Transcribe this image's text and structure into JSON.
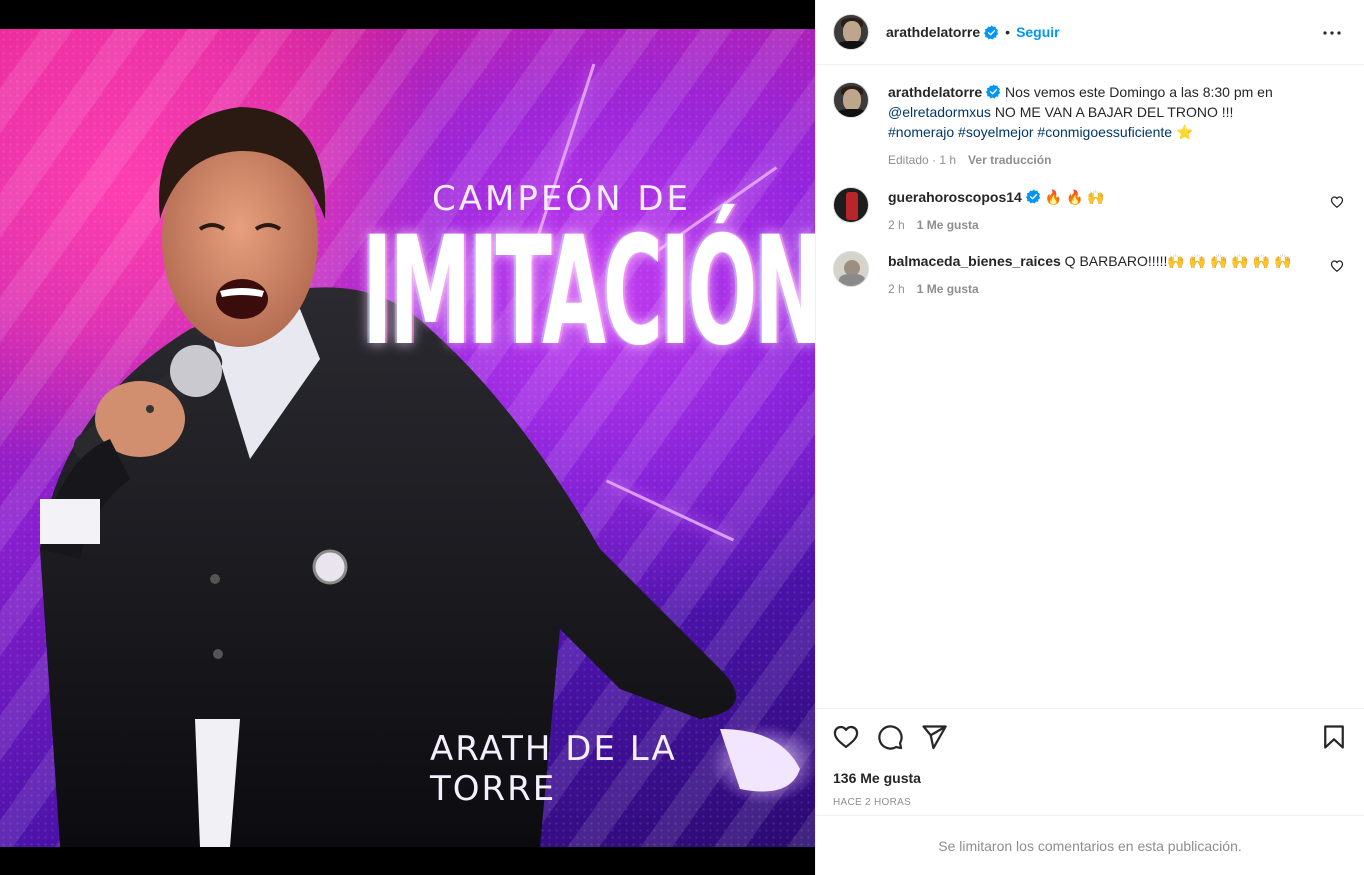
{
  "post": {
    "media": {
      "title_top": "CAMPEÓN DE",
      "title_main": "IMITACIÓN",
      "name_bottom": "ARATH DE LA TORRE"
    },
    "author": {
      "username": "arathdelatorre",
      "separator": "•",
      "follow_label": "Seguir",
      "more_icon": "more-horizontal-icon",
      "verified_icon": "verified-badge-icon"
    },
    "caption": {
      "username": "arathdelatorre",
      "text_part1": "Nos vemos este Domingo a las 8:30 pm en",
      "mention": "@elretadormxus",
      "text_part2": "NO ME VAN A BAJAR DEL TRONO !!!",
      "hashtags": [
        "#nomerajo",
        "#soyelmejor",
        "#conmigoessuficiente"
      ],
      "emoji": "⭐",
      "edited": "Editado · 1 h",
      "translate": "Ver traducción"
    },
    "comments": [
      {
        "username": "guerahoroscopos14",
        "text": "🔥 🔥 🙌",
        "time": "2 h",
        "likes": "1 Me gusta"
      },
      {
        "username": "balmaceda_bienes_raices",
        "text": "Q BARBARO!!!!!🙌 🙌 🙌 🙌 🙌 🙌",
        "time": "2 h",
        "likes": "1 Me gusta"
      }
    ],
    "likes_count": "136 Me gusta",
    "posted_time": "HACE 2 HORAS",
    "comments_limited": "Se limitaron los comentarios en esta publicación."
  },
  "colors": {
    "accent": "#0095f6",
    "link": "#00376b",
    "muted": "#8e8e8e",
    "text": "#262626"
  }
}
